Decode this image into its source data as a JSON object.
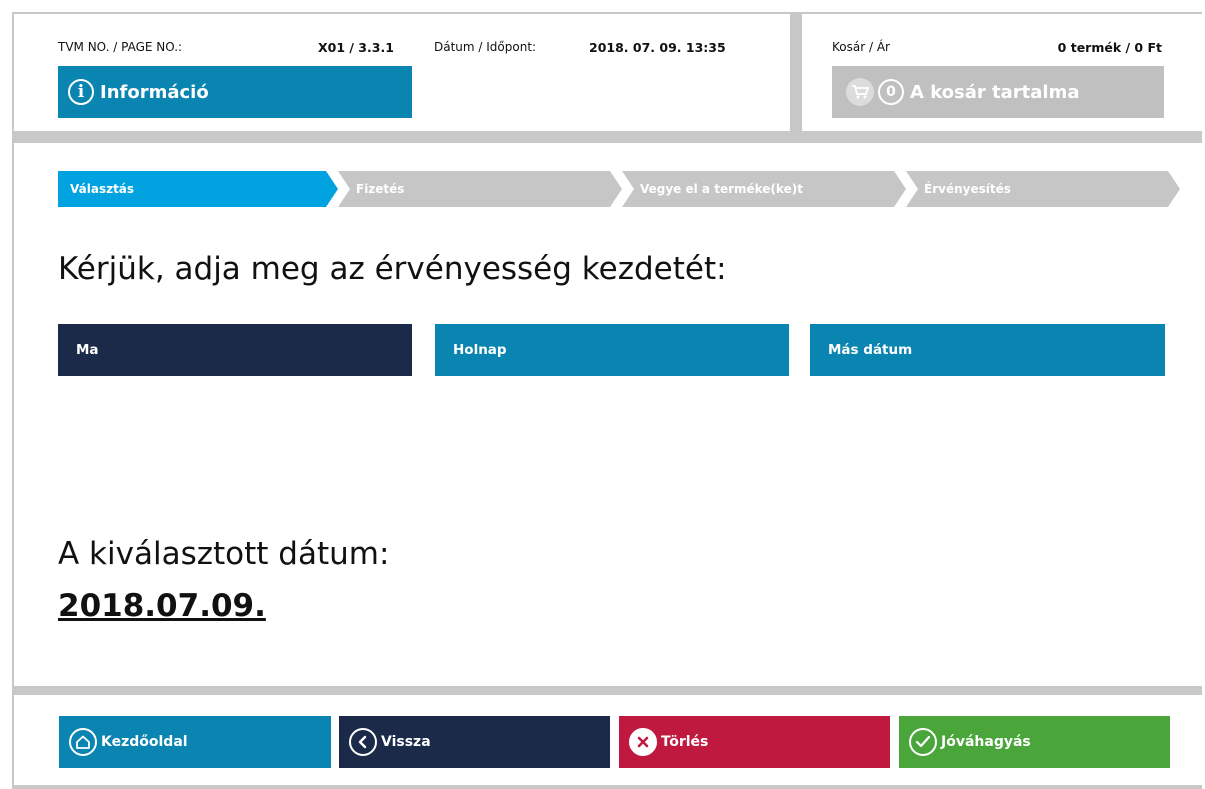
{
  "header": {
    "tvm_label": "TVM NO. / PAGE NO.:",
    "tvm_value": "X01 / 3.3.1",
    "datetime_label": "Dátum / Időpont:",
    "datetime_value": "2018. 07. 09. 13:35",
    "info_button": "Információ",
    "info_icon": "info-icon"
  },
  "cart": {
    "label": "Kosár / Ár",
    "summary": "0 termék / 0 Ft",
    "count": "0",
    "button": "A kosár tartalma",
    "icon": "cart-icon"
  },
  "steps": [
    {
      "label": "Választás",
      "state": "active"
    },
    {
      "label": "Fizetés",
      "state": "inactive"
    },
    {
      "label": "Vegye el a terméke(ke)t",
      "state": "inactive"
    },
    {
      "label": "Érvényesítés",
      "state": "inactive"
    }
  ],
  "main": {
    "prompt": "Kérjük, adja meg az érvényesség kezdetét:",
    "options": [
      {
        "label": "Ma",
        "selected": true
      },
      {
        "label": "Holnap",
        "selected": false
      },
      {
        "label": "Más dátum",
        "selected": false
      }
    ],
    "selected_label": "A kiválasztott dátum:",
    "selected_date": "2018.07.09."
  },
  "footer": {
    "home": "Kezdőoldal",
    "back": "Vissza",
    "delete": "Törlés",
    "confirm": "Jóváhagyás"
  },
  "colors": {
    "primary_blue": "#0a84b0",
    "active_step": "#00a3e0",
    "navy": "#1c2a4a",
    "red": "#c0193f",
    "green": "#4aa63a",
    "disabled_gray": "#c0c0c0"
  }
}
